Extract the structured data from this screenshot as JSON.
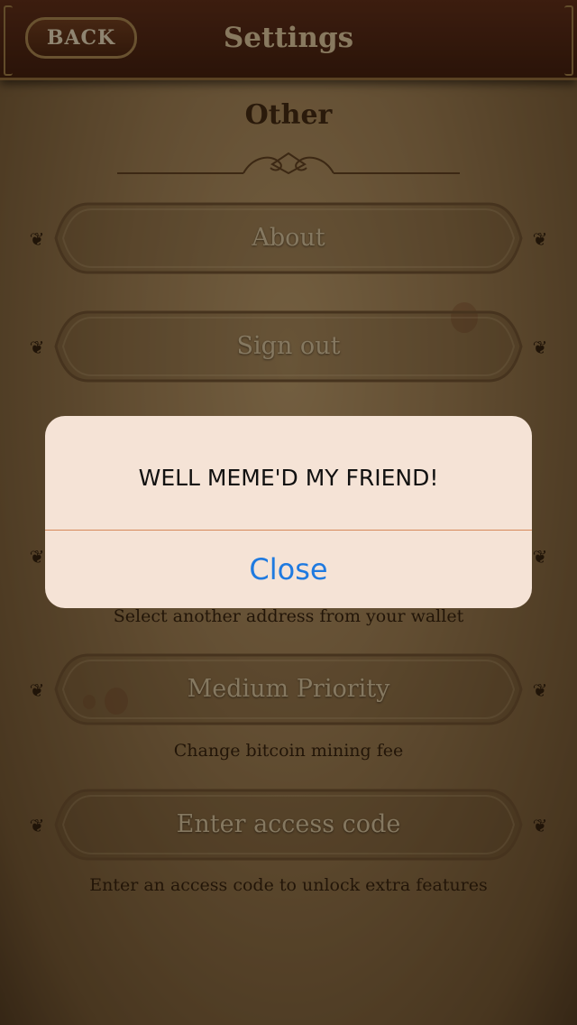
{
  "header": {
    "back_label": "BACK",
    "title": "Settings"
  },
  "section": {
    "heading": "Other"
  },
  "options": [
    {
      "label": "About",
      "description": ""
    },
    {
      "label": "Sign out",
      "description": ""
    },
    {
      "label": "",
      "description": "Select another address from your wallet"
    },
    {
      "label": "Medium Priority",
      "description": "Change bitcoin mining fee"
    },
    {
      "label": "Enter access code",
      "description": "Enter an access code to unlock extra features"
    }
  ],
  "alert": {
    "message": "WELL MEME'D MY FRIEND!",
    "close_label": "Close"
  },
  "colors": {
    "header_bg": "#4a2110",
    "parchment": "#9b7d53",
    "alert_bg": "#f5e3d6",
    "alert_button": "#1f7ae0"
  },
  "icons": {
    "back": "back-button-frame",
    "ornament": "scroll-ornament-icon",
    "fleur": "fleur-icon"
  }
}
